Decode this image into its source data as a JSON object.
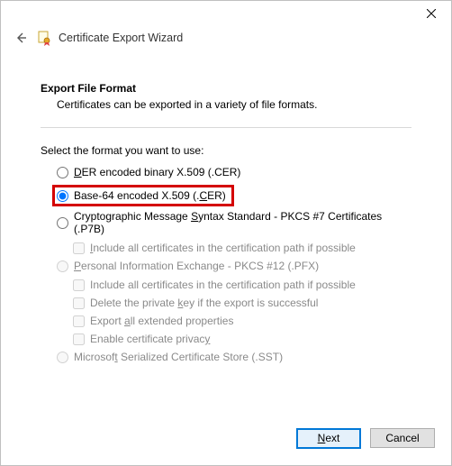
{
  "titlebar": {},
  "header": {
    "title": "Certificate Export Wizard"
  },
  "body": {
    "heading": "Export File Format",
    "subheading": "Certificates can be exported in a variety of file formats.",
    "select_label": "Select the format you want to use:",
    "options": {
      "der": {
        "pre": "",
        "ak": "D",
        "post": "ER encoded binary X.509 (.CER)"
      },
      "b64": {
        "pre": "Base-64 encoded X.509 (.",
        "ak": "C",
        "post": "ER)"
      },
      "p7b": {
        "pre": "Cryptographic Message ",
        "ak": "S",
        "post": "yntax Standard - PKCS #7 Certificates (.P7B)",
        "sub1": {
          "pre": "",
          "ak": "I",
          "post": "nclude all certificates in the certification path if possible"
        }
      },
      "pfx": {
        "pre": "",
        "ak": "P",
        "post": "ersonal Information Exchange - PKCS #12 (.PFX)",
        "sub1": {
          "pre": "Include all certificates in the certification path if possible"
        },
        "sub2": {
          "pre": "Delete the private ",
          "ak": "k",
          "post": "ey if the export is successful"
        },
        "sub3": {
          "pre": "Export ",
          "ak": "a",
          "post": "ll extended properties"
        },
        "sub4": {
          "pre": "Enable certificate privac",
          "ak": "y",
          "post": ""
        }
      },
      "sst": {
        "pre": "Microsof",
        "ak": "t",
        "post": " Serialized Certificate Store (.SST)"
      }
    }
  },
  "footer": {
    "next": {
      "ak": "N",
      "post": "ext"
    },
    "cancel": "Cancel"
  }
}
